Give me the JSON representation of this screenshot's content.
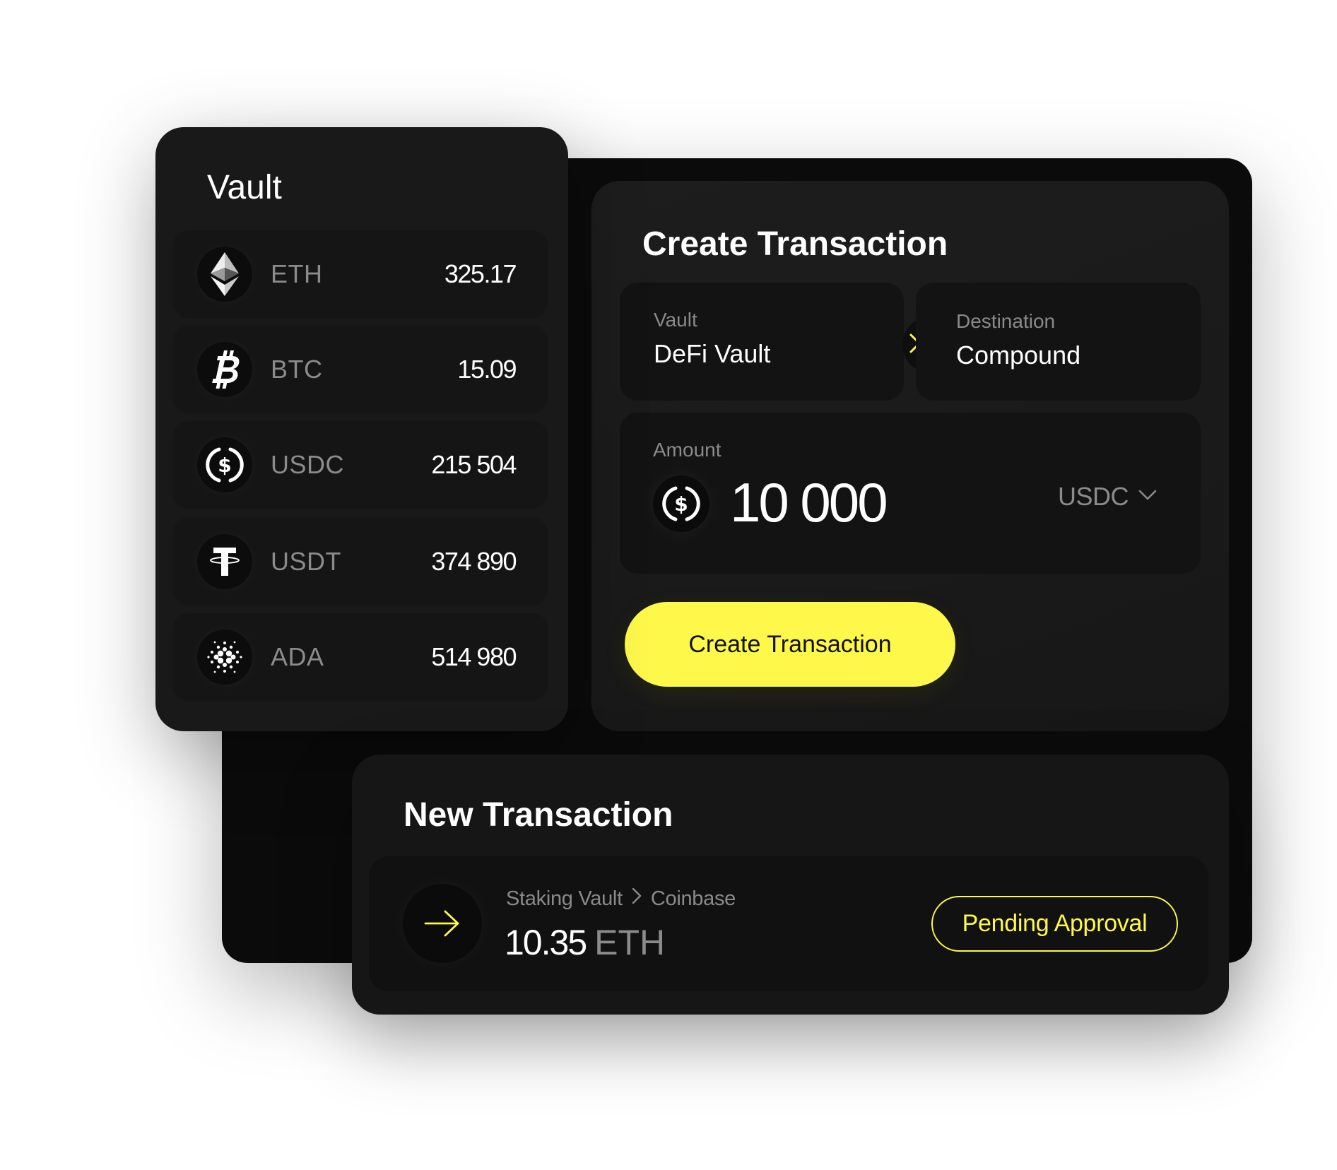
{
  "vault": {
    "title": "Vault",
    "assets": [
      {
        "symbol": "ETH",
        "value": "325.17",
        "icon": "ethereum-icon"
      },
      {
        "symbol": "BTC",
        "value": "15.09",
        "icon": "bitcoin-icon"
      },
      {
        "symbol": "USDC",
        "value": "215 504",
        "icon": "usdc-icon"
      },
      {
        "symbol": "USDT",
        "value": "374 890",
        "icon": "tether-icon"
      },
      {
        "symbol": "ADA",
        "value": "514 980",
        "icon": "cardano-icon"
      }
    ]
  },
  "create_transaction": {
    "title": "Create Transaction",
    "source": {
      "label": "Vault",
      "value": "DeFi Vault"
    },
    "route_icon": "chevron-right-icon",
    "destination": {
      "label": "Destination",
      "value": "Compound"
    },
    "amount": {
      "label": "Amount",
      "value": "10 000",
      "currency": "USDC",
      "currency_icon": "usdc-icon",
      "dropdown_icon": "chevron-down-icon"
    },
    "button_label": "Create Transaction"
  },
  "new_transaction": {
    "title": "New Transaction",
    "icon": "arrow-right-icon",
    "from": "Staking Vault",
    "to": "Coinbase",
    "amount": "10.35",
    "unit": "ETH",
    "status": "Pending Approval"
  },
  "colors": {
    "accent": "#fdf84a",
    "background": "#ffffff",
    "card_dark": "#191919",
    "card_black": "#0b0b0b",
    "muted_text": "#8a8a8a"
  }
}
